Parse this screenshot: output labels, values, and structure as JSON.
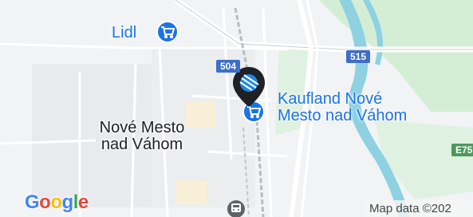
{
  "map": {
    "place_labels": {
      "city": "Nové Mesto\nnad Váhom"
    },
    "pois": {
      "lidl": {
        "label": "Lidl",
        "icon": "shopping-cart-icon"
      },
      "kaufland": {
        "label": "Kaufland Nové\nMesto nad Váhom",
        "icon": "shopping-cart-icon"
      }
    },
    "road_shields": {
      "r504": "504",
      "r515": "515",
      "e75": "E75"
    },
    "selected_pin_icon": "bavarian-flag-pin-icon",
    "transit_icon": "train-station-icon",
    "branding": {
      "logo_text": "Google"
    },
    "attribution": "Map data ©202",
    "colors": {
      "land": "#f1f3f4",
      "water": "#8ed1e0",
      "park": "#c5e8c8",
      "poi_blue": "#1a73e8",
      "road_white": "#ffffff",
      "shield_blue": "#3d6ec9",
      "shield_green": "#4b9a5c"
    }
  }
}
